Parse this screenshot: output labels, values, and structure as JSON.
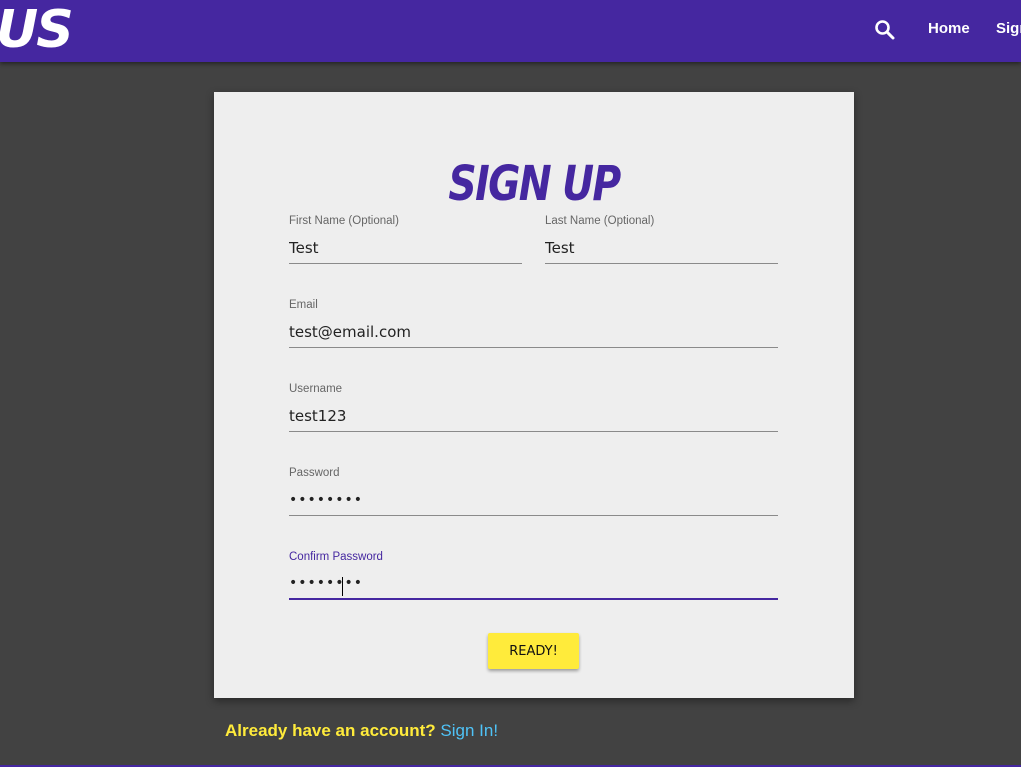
{
  "navbar": {
    "logo_text": "US",
    "search_icon": "search-icon",
    "links": [
      "Home",
      "Sign"
    ]
  },
  "colors": {
    "navbar": "#4527a0",
    "background": "#424242",
    "card": "#eeeeee",
    "accent": "#4527a0",
    "button": "#ffeb3b",
    "prompt": "#ffeb3b",
    "link": "#4fc3f7"
  },
  "form": {
    "title": "SIGN UP",
    "first_name": {
      "label": "First Name (Optional)",
      "value": "Test"
    },
    "last_name": {
      "label": "Last Name (Optional)",
      "value": "Test"
    },
    "email": {
      "label": "Email",
      "value": "test@email.com"
    },
    "username": {
      "label": "Username",
      "value": "test123"
    },
    "password": {
      "label": "Password",
      "value": "••••••••"
    },
    "confirm_password": {
      "label": "Confirm Password",
      "value": "••••••••"
    },
    "submit_label": "READY!"
  },
  "footer": {
    "prompt": "Already have an account?",
    "link": "Sign In!"
  }
}
